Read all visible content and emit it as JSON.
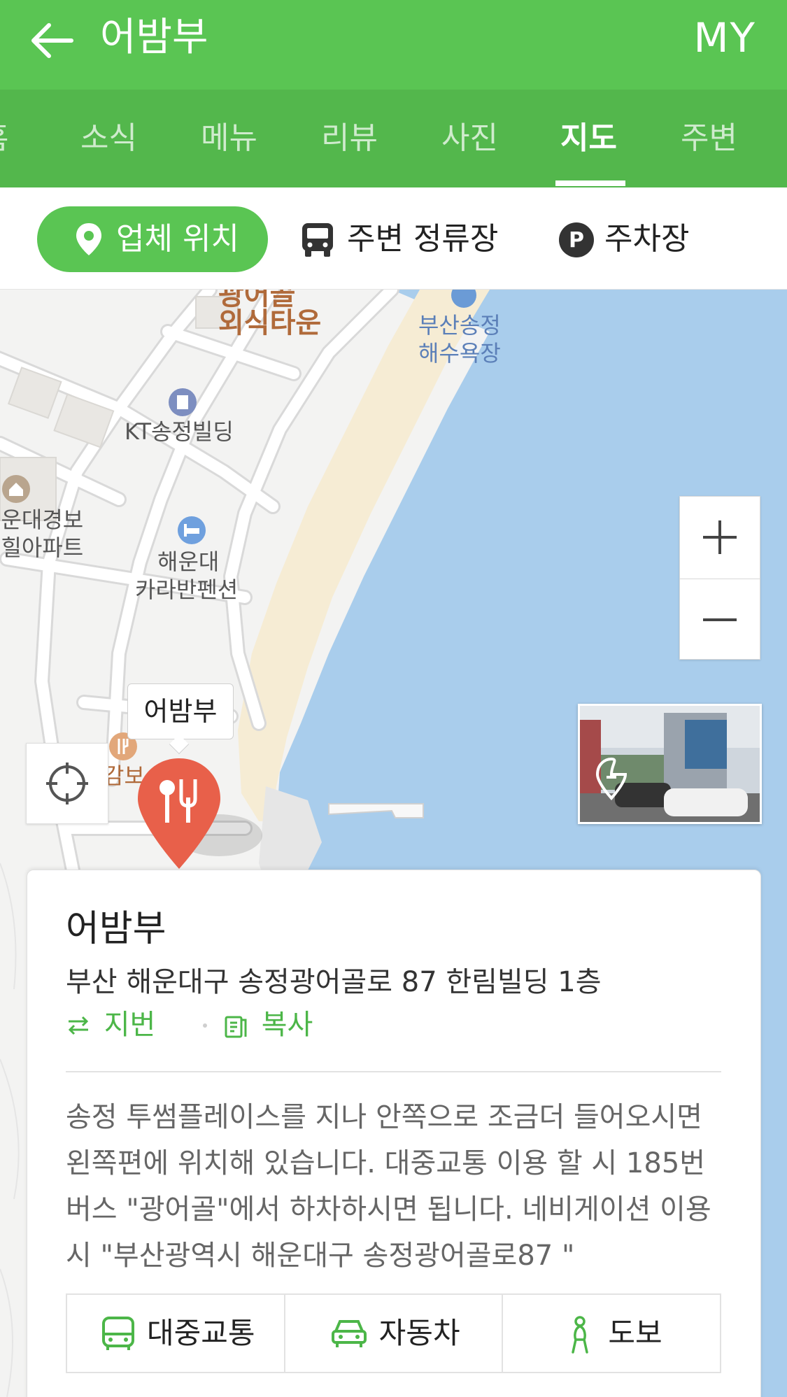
{
  "header": {
    "title": "어밤부",
    "my_label": "MY",
    "accent": "#5ac553"
  },
  "tabs": [
    {
      "label": "홈",
      "active": false
    },
    {
      "label": "소식",
      "active": false
    },
    {
      "label": "메뉴",
      "active": false
    },
    {
      "label": "리뷰",
      "active": false
    },
    {
      "label": "사진",
      "active": false
    },
    {
      "label": "지도",
      "active": true
    },
    {
      "label": "주변",
      "active": false
    }
  ],
  "filters": {
    "location": "업체 위치",
    "stops": "주변 정류장",
    "parking": "주차장",
    "parking_icon_letter": "P"
  },
  "map": {
    "labels": {
      "food_town": "외식타운",
      "food_town_top": "광어골",
      "beach_line1": "부산송정",
      "beach_line2": "해수욕장",
      "kt": "KT송정빌딩",
      "apt_line1": "해운대경보",
      "apt_line2": "이힐아파트",
      "pension_line1": "해운대",
      "pension_line2": "카라반펜션",
      "nearby_partial": "감보"
    },
    "marker_label": "어밤부",
    "marker_color": "#e8604a"
  },
  "card": {
    "title": "어밤부",
    "address": "부산 해운대구 송정광어골로 87 한림빌딩 1층",
    "jibun_label": "지번",
    "copy_label": "복사",
    "description": "송정 투썸플레이스를 지나 안쪽으로 조금더 들어오시면 왼쪽편에 위치해 있습니다. 대중교통 이용 할 시 185번 버스 \"광어골\"에서 하차하시면 됩니다. 네비게이션 이용시 \"부산광역시 해운대구 송정광어골로87 \"",
    "transport": {
      "transit": "대중교통",
      "car": "자동차",
      "walk": "도보"
    }
  }
}
